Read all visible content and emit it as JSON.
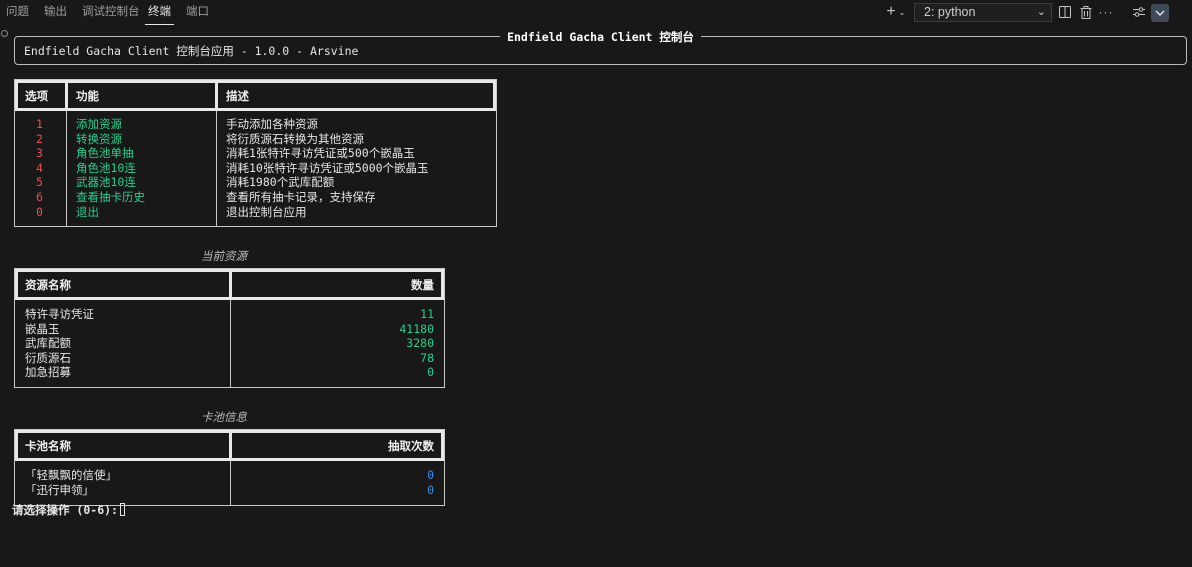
{
  "panel": {
    "tabs": [
      "问题",
      "输出",
      "调试控制台",
      "终端",
      "端口"
    ],
    "active_tab": "终端",
    "terminal_selector": "2: python",
    "icons": [
      "plus-icon",
      "chevron-down-icon",
      "split-terminal-icon",
      "trash-icon",
      "more-icon",
      "settings-icon",
      "collapse-panel-icon"
    ]
  },
  "banner": {
    "title": "Endfield Gacha Client 控制台",
    "subtitle": "Endfield Gacha Client 控制台应用 - 1.0.0 - Arsvine"
  },
  "menu_table": {
    "headers": [
      "选项",
      "功能",
      "描述"
    ],
    "rows": [
      {
        "option": "1",
        "function": "添加资源",
        "desc": "手动添加各种资源"
      },
      {
        "option": "2",
        "function": "转换资源",
        "desc": "将衍质源石转换为其他资源"
      },
      {
        "option": "3",
        "function": "角色池单抽",
        "desc": "消耗1张特许寻访凭证或500个嵌晶玉"
      },
      {
        "option": "4",
        "function": "角色池10连",
        "desc": "消耗10张特许寻访凭证或5000个嵌晶玉"
      },
      {
        "option": "5",
        "function": "武器池10连",
        "desc": "消耗1980个武库配额"
      },
      {
        "option": "6",
        "function": "查看抽卡历史",
        "desc": "查看所有抽卡记录，支持保存"
      },
      {
        "option": "0",
        "function": "退出",
        "desc": "退出控制台应用"
      }
    ]
  },
  "resources": {
    "title": "当前资源",
    "headers": [
      "资源名称",
      "数量"
    ],
    "rows": [
      {
        "name": "特许寻访凭证",
        "qty": "11"
      },
      {
        "name": "嵌晶玉",
        "qty": "41180"
      },
      {
        "name": "武库配额",
        "qty": "3280"
      },
      {
        "name": "衍质源石",
        "qty": "78"
      },
      {
        "name": "加急招募",
        "qty": "0"
      }
    ]
  },
  "pools": {
    "title": "卡池信息",
    "headers": [
      "卡池名称",
      "抽取次数"
    ],
    "rows": [
      {
        "name": "「轻飘飘的信使」",
        "count": "0"
      },
      {
        "name": "「迅行申领」",
        "count": "0"
      }
    ]
  },
  "prompt": "请选择操作 (0-6):"
}
